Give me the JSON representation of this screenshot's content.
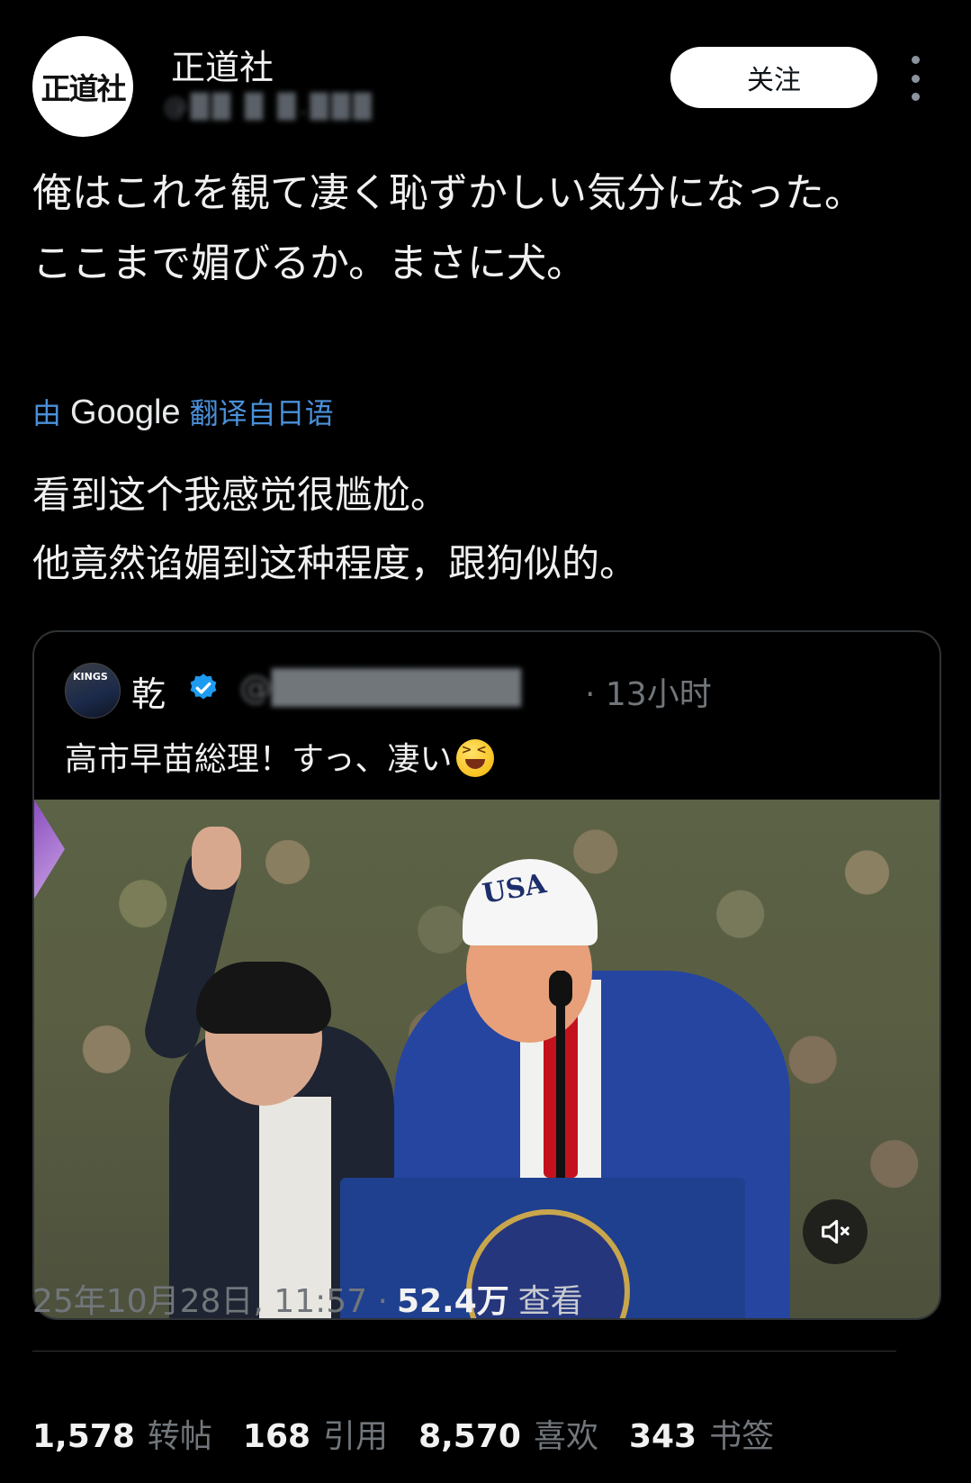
{
  "header": {
    "avatar_text": "正道社",
    "display_name": "正道社",
    "handle": "@██ █ █.███",
    "follow_label": "关注",
    "more_icon": "more-vertical-icon"
  },
  "post": {
    "text": "俺はこれを観て凄く恥ずかしい気分になった。\nここまで媚びるか。まさに犬。",
    "translate_prefix": "由",
    "translate_brand": "Google",
    "translate_suffix": "翻译自日语",
    "translated_text": "看到这个我感觉很尴尬。\n他竟然谄媚到这种程度，跟狗似的。"
  },
  "quote": {
    "avatar_text": "KINGS",
    "name": "乾",
    "verified_icon": "verified-badge-icon",
    "handle": "@██████████",
    "time": "· 13小时",
    "text": "高市早苗総理！すっ、凄い",
    "emoji": "grinning-squinting-face-icon",
    "video": {
      "cap_text": "USA",
      "mute_icon": "speaker-muted-icon"
    }
  },
  "meta": {
    "timestamp": "25年10月28日, 11:57 ·",
    "views_count": "52.4万",
    "views_label": "查看"
  },
  "stats": {
    "reposts_count": "1,578",
    "reposts_label": "转帖",
    "quotes_count": "168",
    "quotes_label": "引用",
    "likes_count": "8,570",
    "likes_label": "喜欢",
    "bookmarks_count": "343",
    "bookmarks_label": "书签"
  },
  "colors": {
    "background": "#000000",
    "link_blue": "#4a90d9",
    "muted": "#71767b",
    "verified": "#1d9bf0"
  }
}
